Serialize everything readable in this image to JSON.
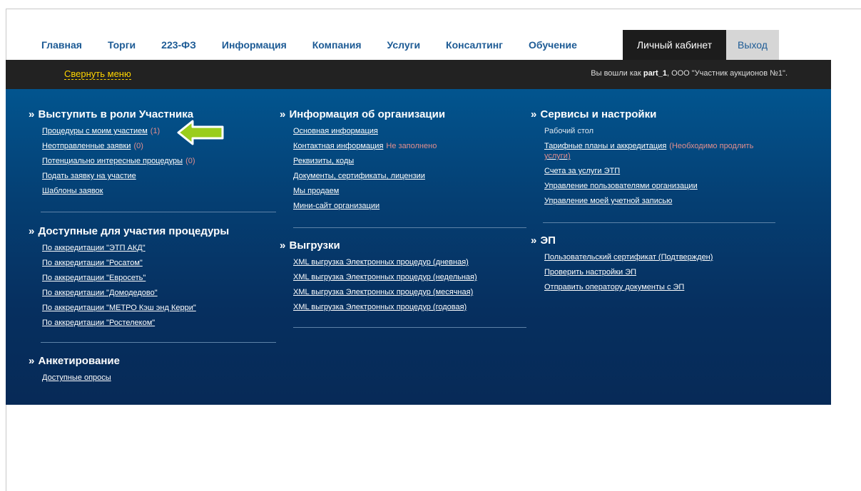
{
  "nav": {
    "items": [
      "Главная",
      "Торги",
      "223-ФЗ",
      "Информация",
      "Компания",
      "Услуги",
      "Консалтинг",
      "Обучение"
    ],
    "cabinet": "Личный кабинет",
    "logout": "Выход"
  },
  "userbar": {
    "collapse": "Свернуть меню",
    "logged_prefix": "Вы вошли как",
    "username": "part_1",
    "org": ", ООО \"Участник аукционов №1\"."
  },
  "sections": {
    "participant": {
      "title": "Выступить в роли Участника",
      "links": [
        {
          "label": "Процедуры с моим участием",
          "count": "(1)"
        },
        {
          "label": "Неотправленные заявки",
          "count": "(0)"
        },
        {
          "label": "Потенциально интересные процедуры",
          "count": "(0)"
        },
        {
          "label": "Подать заявку на участие",
          "count": ""
        },
        {
          "label": "Шаблоны заявок",
          "count": ""
        }
      ]
    },
    "available": {
      "title": "Доступные для участия процедуры",
      "links": [
        "По аккредитации \"ЭТП АКД\"",
        "По аккредитации \"Росатом\"",
        "По аккредитации \"Евросеть\"",
        "По аккредитации \"Домодедово\"",
        "По аккредитации \"МЕТРО Кэш энд Керри\"",
        "По аккредитации \"Ростелеком\""
      ]
    },
    "survey": {
      "title": "Анкетирование",
      "links": [
        "Доступные опросы"
      ]
    },
    "org": {
      "title": "Информация об организации",
      "links": [
        {
          "label": "Основная информация",
          "note": ""
        },
        {
          "label": "Контактная информация",
          "note": "Не заполнено"
        },
        {
          "label": "Реквизиты, коды",
          "note": ""
        },
        {
          "label": "Документы, сертификаты, лицензии",
          "note": ""
        },
        {
          "label": "Мы продаем",
          "note": ""
        },
        {
          "label": "Мини-сайт организации",
          "note": ""
        }
      ]
    },
    "exports": {
      "title": "Выгрузки",
      "links": [
        "XML выгрузка Электронных процедур (дневная)",
        "XML выгрузка Электронных процедур (недельная)",
        "XML выгрузка Электронных процедур (месячная)",
        "XML выгрузка Электронных процедур (годовая)"
      ]
    },
    "services": {
      "title": "Сервисы и настройки",
      "desktop": "Рабочий стол",
      "tariff_label": "Тарифные планы и аккредитация",
      "tariff_note_1": "(Необходимо продлить",
      "tariff_note_2": "услуги)",
      "links": [
        "Счета за услуги ЭТП",
        "Управление пользователями организации",
        "Управление моей учетной записью"
      ]
    },
    "ep": {
      "title": "ЭП",
      "links": [
        "Пользовательский сертификат (Подтвержден)",
        "Проверить настройки ЭП",
        "Отправить оператору документы с ЭП"
      ]
    }
  },
  "chevron": "»",
  "colors": {
    "nav_text": "#1d5b95",
    "highlight_arrow": "#9acd1c",
    "warning": "#e28e8e",
    "panel": "#053f73"
  }
}
